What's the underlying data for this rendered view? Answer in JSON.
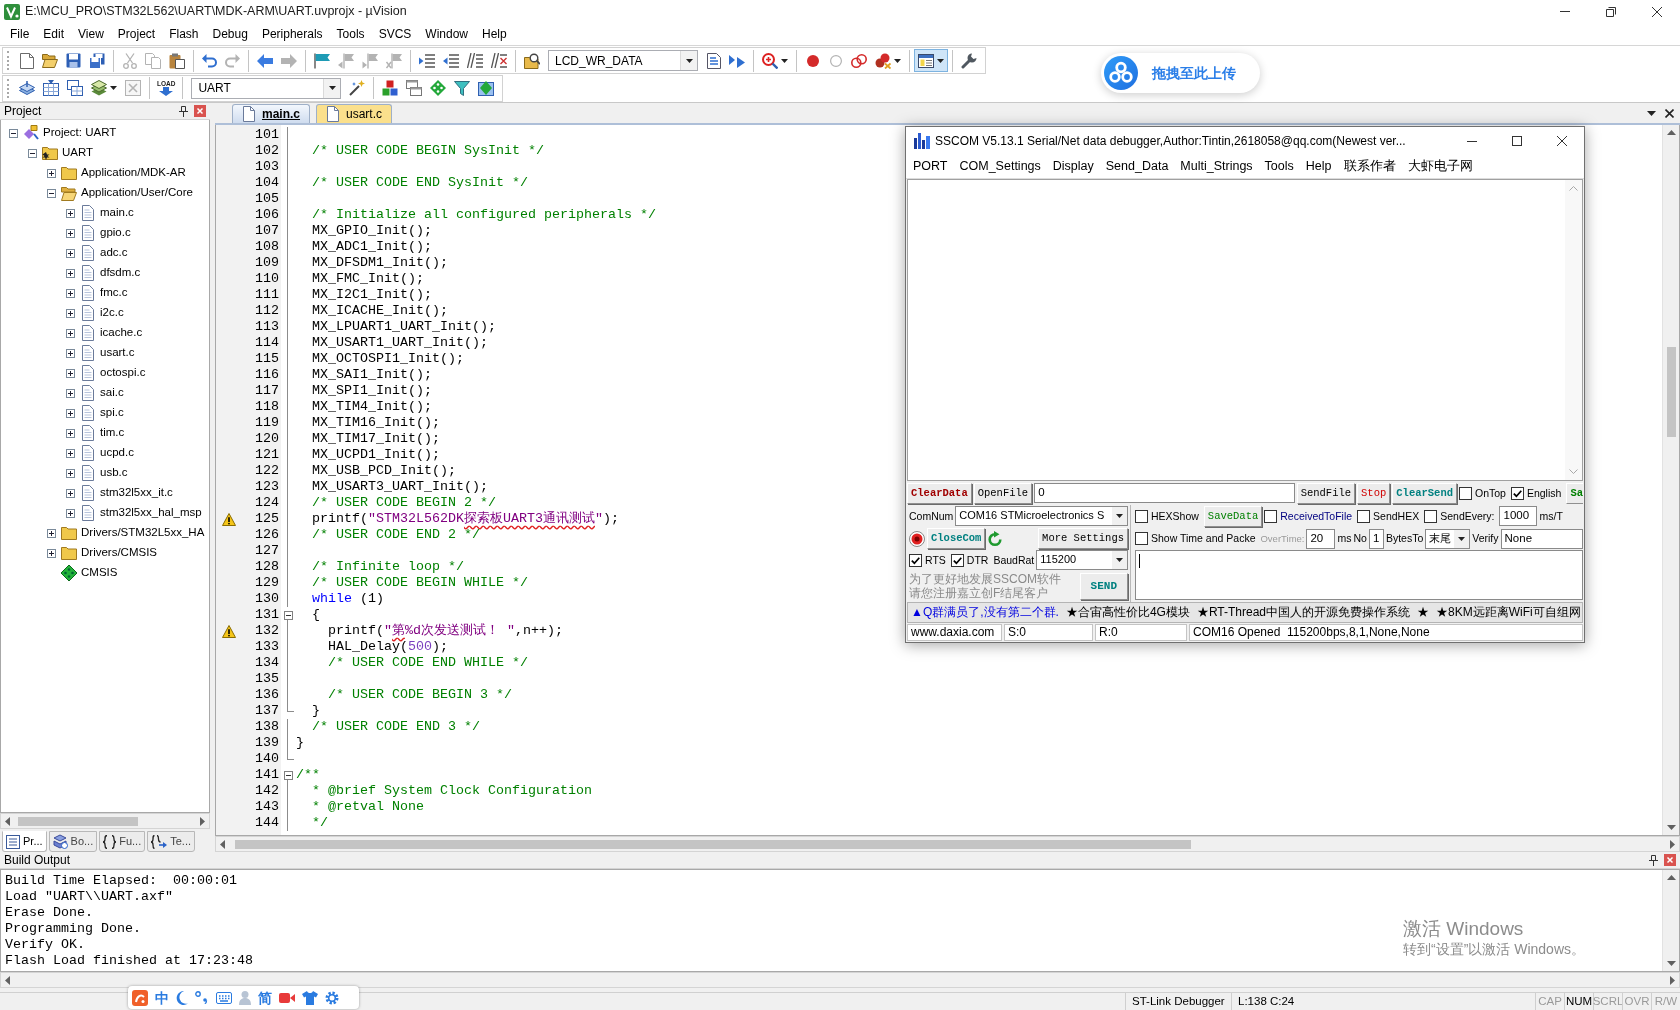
{
  "window": {
    "title": "E:\\MCU_PRO\\STM32L562\\UART\\MDK-ARM\\UART.uvprojx - µVision"
  },
  "menu": [
    "File",
    "Edit",
    "View",
    "Project",
    "Flash",
    "Debug",
    "Peripherals",
    "Tools",
    "SVCS",
    "Window",
    "Help"
  ],
  "toolbar_1": [
    [
      {
        "kind": "new",
        "disabled": false,
        "pressed": false
      },
      {
        "kind": "open",
        "disabled": false,
        "pressed": false
      },
      {
        "kind": "save",
        "disabled": false,
        "pressed": false
      },
      {
        "kind": "save_all",
        "disabled": false,
        "pressed": false
      }
    ],
    [
      {
        "kind": "cut",
        "disabled": true,
        "pressed": false
      },
      {
        "kind": "copy",
        "disabled": true,
        "pressed": false
      },
      {
        "kind": "paste",
        "disabled": false,
        "pressed": false
      }
    ],
    [
      {
        "kind": "undo",
        "disabled": false,
        "pressed": false
      },
      {
        "kind": "redo",
        "disabled": true,
        "pressed": false
      }
    ],
    [
      {
        "kind": "back",
        "disabled": false,
        "pressed": false
      },
      {
        "kind": "forward",
        "disabled": true,
        "pressed": false
      }
    ],
    [
      {
        "kind": "bookmark",
        "disabled": false,
        "pressed": false
      },
      {
        "kind": "prev_bookmark",
        "disabled": true,
        "pressed": false
      },
      {
        "kind": "next_bookmark",
        "disabled": true,
        "pressed": false
      },
      {
        "kind": "clear_bookmarks",
        "disabled": true,
        "pressed": false
      }
    ],
    [
      {
        "kind": "indent",
        "disabled": false,
        "pressed": false
      },
      {
        "kind": "unindent",
        "disabled": false,
        "pressed": false
      },
      {
        "kind": "comment",
        "disabled": false,
        "pressed": false
      },
      {
        "kind": "uncomment",
        "disabled": false,
        "pressed": false
      }
    ],
    [
      {
        "kind": "find_in_files",
        "disabled": false,
        "pressed": false
      },
      {
        "kind": "combo",
        "value": "LCD_WR_DATA"
      },
      {
        "kind": "find",
        "disabled": false,
        "pressed": false
      },
      {
        "kind": "incremental_find",
        "disabled": false,
        "pressed": false
      }
    ],
    [
      {
        "kind": "debug",
        "disabled": false,
        "pressed": false
      }
    ],
    [
      {
        "kind": "breakpoint",
        "disabled": false,
        "pressed": false
      },
      {
        "kind": "enable_breakpoint",
        "disabled": true,
        "pressed": false
      },
      {
        "kind": "disable_breakpoints",
        "disabled": false,
        "pressed": false
      },
      {
        "kind": "kill_breakpoints",
        "disabled": false,
        "pressed": false
      }
    ],
    [
      {
        "kind": "windows",
        "disabled": false,
        "pressed": true
      }
    ],
    [
      {
        "kind": "configure",
        "disabled": false,
        "pressed": false
      }
    ]
  ],
  "toolbar_2": [
    [
      {
        "kind": "translate",
        "disabled": false,
        "pressed": false
      },
      {
        "kind": "build",
        "disabled": false,
        "pressed": false
      },
      {
        "kind": "rebuild",
        "disabled": false,
        "pressed": false
      },
      {
        "kind": "batch_build",
        "disabled": false,
        "pressed": false
      },
      {
        "kind": "stop_build",
        "disabled": true,
        "pressed": false
      }
    ],
    [
      {
        "kind": "download",
        "label": "LOAD",
        "disabled": false,
        "pressed": false
      }
    ],
    [
      {
        "kind": "combo",
        "value": "UART"
      },
      {
        "kind": "target_options",
        "disabled": false,
        "pressed": false
      }
    ],
    [
      {
        "kind": "components",
        "disabled": false,
        "pressed": false
      },
      {
        "kind": "copy_windows",
        "disabled": false,
        "pressed": false
      },
      {
        "kind": "pack_installer",
        "disabled": false,
        "pressed": false
      },
      {
        "kind": "select_packs",
        "disabled": false,
        "pressed": false
      },
      {
        "kind": "rte",
        "disabled": false,
        "pressed": false
      }
    ]
  ],
  "upload_bubble": {
    "text": "拖拽至此上传"
  },
  "project_panel": {
    "title": "Project",
    "tree": [
      {
        "kind": "project",
        "label": "Project: UART",
        "expanded": true,
        "children": [
          {
            "kind": "target",
            "label": "UART",
            "expanded": true,
            "children": [
              {
                "kind": "group",
                "label": "Application/MDK-AR",
                "expanded": false
              },
              {
                "kind": "group",
                "label": "Application/User/Core",
                "expanded": true,
                "children": [
                  {
                    "kind": "file",
                    "label": "main.c",
                    "expanded": false
                  },
                  {
                    "kind": "file",
                    "label": "gpio.c",
                    "expanded": false
                  },
                  {
                    "kind": "file",
                    "label": "adc.c",
                    "expanded": false
                  },
                  {
                    "kind": "file",
                    "label": "dfsdm.c",
                    "expanded": false
                  },
                  {
                    "kind": "file",
                    "label": "fmc.c",
                    "expanded": false
                  },
                  {
                    "kind": "file",
                    "label": "i2c.c",
                    "expanded": false
                  },
                  {
                    "kind": "file",
                    "label": "icache.c",
                    "expanded": false
                  },
                  {
                    "kind": "file",
                    "label": "usart.c",
                    "expanded": false
                  },
                  {
                    "kind": "file",
                    "label": "octospi.c",
                    "expanded": false
                  },
                  {
                    "kind": "file",
                    "label": "sai.c",
                    "expanded": false
                  },
                  {
                    "kind": "file",
                    "label": "spi.c",
                    "expanded": false
                  },
                  {
                    "kind": "file",
                    "label": "tim.c",
                    "expanded": false
                  },
                  {
                    "kind": "file",
                    "label": "ucpd.c",
                    "expanded": false
                  },
                  {
                    "kind": "file",
                    "label": "usb.c",
                    "expanded": false
                  },
                  {
                    "kind": "file",
                    "label": "stm32l5xx_it.c",
                    "expanded": false
                  },
                  {
                    "kind": "file",
                    "label": "stm32l5xx_hal_msp",
                    "expanded": false
                  }
                ]
              },
              {
                "kind": "group",
                "label": "Drivers/STM32L5xx_HA",
                "expanded": false
              },
              {
                "kind": "group",
                "label": "Drivers/CMSIS",
                "expanded": false
              },
              {
                "kind": "component",
                "label": "CMSIS"
              }
            ]
          }
        ]
      }
    ],
    "tabs": [
      {
        "kind": "project",
        "label": "Pr...",
        "selected": true
      },
      {
        "kind": "books",
        "label": "Bo...",
        "selected": false
      },
      {
        "kind": "functions",
        "label": "Fu...",
        "selected": false
      },
      {
        "kind": "templates",
        "label": "Te...",
        "selected": false
      }
    ]
  },
  "editor": {
    "tabs": [
      {
        "label": "main.c",
        "selected": true
      },
      {
        "label": "usart.c",
        "selected": false
      }
    ],
    "lines": [
      {
        "number": "101",
        "fold_start": false,
        "fold_end": false,
        "warning": false
      },
      {
        "number": "102",
        "fold_start": false,
        "fold_end": false,
        "warning": false,
        "code": [
          {
            "kind": "comment",
            "text": "  /* USER CODE BEGIN SysInit */"
          }
        ]
      },
      {
        "number": "103",
        "fold_start": false,
        "fold_end": false,
        "warning": false
      },
      {
        "number": "104",
        "fold_start": false,
        "fold_end": false,
        "warning": false,
        "code": [
          {
            "kind": "comment",
            "text": "  /* USER CODE END SysInit */"
          }
        ]
      },
      {
        "number": "105",
        "fold_start": false,
        "fold_end": false,
        "warning": false
      },
      {
        "number": "106",
        "fold_start": false,
        "fold_end": false,
        "warning": false,
        "code": [
          {
            "kind": "comment",
            "text": "  /* Initialize all configured peripherals */"
          }
        ]
      },
      {
        "number": "107",
        "fold_start": false,
        "fold_end": false,
        "warning": false,
        "code": [
          {
            "kind": "plain",
            "text": "  MX_GPIO_Init();"
          }
        ]
      },
      {
        "number": "108",
        "fold_start": false,
        "fold_end": false,
        "warning": false,
        "code": [
          {
            "kind": "plain",
            "text": "  MX_ADC1_Init();"
          }
        ]
      },
      {
        "number": "109",
        "fold_start": false,
        "fold_end": false,
        "warning": false,
        "code": [
          {
            "kind": "plain",
            "text": "  MX_DFSDM1_Init();"
          }
        ]
      },
      {
        "number": "110",
        "fold_start": false,
        "fold_end": false,
        "warning": false,
        "code": [
          {
            "kind": "plain",
            "text": "  MX_FMC_Init();"
          }
        ]
      },
      {
        "number": "111",
        "fold_start": false,
        "fold_end": false,
        "warning": false,
        "code": [
          {
            "kind": "plain",
            "text": "  MX_I2C1_Init();"
          }
        ]
      },
      {
        "number": "112",
        "fold_start": false,
        "fold_end": false,
        "warning": false,
        "code": [
          {
            "kind": "plain",
            "text": "  MX_ICACHE_Init();"
          }
        ]
      },
      {
        "number": "113",
        "fold_start": false,
        "fold_end": false,
        "warning": false,
        "code": [
          {
            "kind": "plain",
            "text": "  MX_LPUART1_UART_Init();"
          }
        ]
      },
      {
        "number": "114",
        "fold_start": false,
        "fold_end": false,
        "warning": false,
        "code": [
          {
            "kind": "plain",
            "text": "  MX_USART1_UART_Init();"
          }
        ]
      },
      {
        "number": "115",
        "fold_start": false,
        "fold_end": false,
        "warning": false,
        "code": [
          {
            "kind": "plain",
            "text": "  MX_OCTOSPI1_Init();"
          }
        ]
      },
      {
        "number": "116",
        "fold_start": false,
        "fold_end": false,
        "warning": false,
        "code": [
          {
            "kind": "plain",
            "text": "  MX_SAI1_Init();"
          }
        ]
      },
      {
        "number": "117",
        "fold_start": false,
        "fold_end": false,
        "warning": false,
        "code": [
          {
            "kind": "plain",
            "text": "  MX_SPI1_Init();"
          }
        ]
      },
      {
        "number": "118",
        "fold_start": false,
        "fold_end": false,
        "warning": false,
        "code": [
          {
            "kind": "plain",
            "text": "  MX_TIM4_Init();"
          }
        ]
      },
      {
        "number": "119",
        "fold_start": false,
        "fold_end": false,
        "warning": false,
        "code": [
          {
            "kind": "plain",
            "text": "  MX_TIM16_Init();"
          }
        ]
      },
      {
        "number": "120",
        "fold_start": false,
        "fold_end": false,
        "warning": false,
        "code": [
          {
            "kind": "plain",
            "text": "  MX_TIM17_Init();"
          }
        ]
      },
      {
        "number": "121",
        "fold_start": false,
        "fold_end": false,
        "warning": false,
        "code": [
          {
            "kind": "plain",
            "text": "  MX_UCPD1_Init();"
          }
        ]
      },
      {
        "number": "122",
        "fold_start": false,
        "fold_end": false,
        "warning": false,
        "code": [
          {
            "kind": "plain",
            "text": "  MX_USB_PCD_Init();"
          }
        ]
      },
      {
        "number": "123",
        "fold_start": false,
        "fold_end": false,
        "warning": false,
        "code": [
          {
            "kind": "plain",
            "text": "  MX_USART3_UART_Init();"
          }
        ]
      },
      {
        "number": "124",
        "fold_start": false,
        "fold_end": false,
        "warning": false,
        "code": [
          {
            "kind": "comment",
            "text": "  /* USER CODE BEGIN 2 */"
          }
        ]
      },
      {
        "number": "125",
        "fold_start": false,
        "fold_end": false,
        "warning": true,
        "code": [
          {
            "kind": "plain",
            "text": "  printf("
          },
          {
            "kind": "string",
            "text": "\"STM32L562DK"
          },
          {
            "kind": "flagged",
            "text": "探索板UART3通讯测试"
          },
          {
            "kind": "string",
            "text": "\""
          },
          {
            "kind": "plain",
            "text": ");"
          }
        ]
      },
      {
        "number": "126",
        "fold_start": false,
        "fold_end": false,
        "warning": false,
        "code": [
          {
            "kind": "comment",
            "text": "  /* USER CODE END 2 */"
          }
        ]
      },
      {
        "number": "127",
        "fold_start": false,
        "fold_end": false,
        "warning": false
      },
      {
        "number": "128",
        "fold_start": false,
        "fold_end": false,
        "warning": false,
        "code": [
          {
            "kind": "comment",
            "text": "  /* Infinite loop */"
          }
        ]
      },
      {
        "number": "129",
        "fold_start": false,
        "fold_end": false,
        "warning": false,
        "code": [
          {
            "kind": "comment",
            "text": "  /* USER CODE BEGIN WHILE */"
          }
        ]
      },
      {
        "number": "130",
        "fold_start": false,
        "fold_end": false,
        "warning": false,
        "code": [
          {
            "kind": "keyword",
            "text": "  while"
          },
          {
            "kind": "plain",
            "text": " (1)"
          }
        ]
      },
      {
        "number": "131",
        "fold_start": true,
        "fold_end": false,
        "warning": false,
        "code": [
          {
            "kind": "plain",
            "text": "  {"
          }
        ]
      },
      {
        "number": "132",
        "fold_start": false,
        "fold_end": false,
        "warning": true,
        "code": [
          {
            "kind": "plain",
            "text": "    printf("
          },
          {
            "kind": "string",
            "text": "\""
          },
          {
            "kind": "flagged",
            "text": "第"
          },
          {
            "kind": "string",
            "text": "%d次发送测试！ \""
          },
          {
            "kind": "plain",
            "text": ",n++);"
          }
        ]
      },
      {
        "number": "133",
        "fold_start": false,
        "fold_end": false,
        "warning": false,
        "code": [
          {
            "kind": "plain",
            "text": "    HAL_Delay("
          },
          {
            "kind": "number",
            "text": "500"
          },
          {
            "kind": "plain",
            "text": ");"
          }
        ]
      },
      {
        "number": "134",
        "fold_start": false,
        "fold_end": false,
        "warning": false,
        "code": [
          {
            "kind": "comment",
            "text": "    /* USER CODE END WHILE */"
          }
        ]
      },
      {
        "number": "135",
        "fold_start": false,
        "fold_end": false,
        "warning": false
      },
      {
        "number": "136",
        "fold_start": false,
        "fold_end": false,
        "warning": false,
        "code": [
          {
            "kind": "comment",
            "text": "    /* USER CODE BEGIN 3 */"
          }
        ]
      },
      {
        "number": "137",
        "fold_start": false,
        "fold_end": true,
        "warning": false,
        "code": [
          {
            "kind": "plain",
            "text": "  }"
          }
        ]
      },
      {
        "number": "138",
        "fold_start": false,
        "fold_end": false,
        "warning": false,
        "code": [
          {
            "kind": "comment",
            "text": "  /* USER CODE END 3 */"
          }
        ]
      },
      {
        "number": "139",
        "fold_start": false,
        "fold_end": false,
        "warning": false,
        "code": [
          {
            "kind": "plain",
            "text": "}"
          }
        ]
      },
      {
        "number": "140",
        "fold_start": false,
        "fold_end": true,
        "warning": false
      },
      {
        "number": "141",
        "fold_start": true,
        "fold_end": false,
        "warning": false,
        "code": [
          {
            "kind": "comment",
            "text": "/**"
          }
        ]
      },
      {
        "number": "142",
        "fold_start": false,
        "fold_end": false,
        "warning": false,
        "code": [
          {
            "kind": "comment",
            "text": "  * @brief System Clock Configuration"
          }
        ]
      },
      {
        "number": "143",
        "fold_start": false,
        "fold_end": false,
        "warning": false,
        "code": [
          {
            "kind": "comment",
            "text": "  * @retval None"
          }
        ]
      },
      {
        "number": "144",
        "fold_start": false,
        "fold_end": false,
        "warning": false,
        "code": [
          {
            "kind": "comment",
            "text": "  */"
          }
        ]
      }
    ]
  },
  "sscom": {
    "title": "SSCOM V5.13.1 Serial/Net data debugger,Author:Tintin,2618058@qq.com(Newest ver...",
    "menu": [
      "PORT",
      "COM_Settings",
      "Display",
      "Send_Data",
      "Multi_Strings",
      "Tools",
      "Help",
      "联系作者",
      "大虾电子网"
    ],
    "clear_data": "ClearData",
    "open_file": "OpenFile",
    "file_path": "0",
    "send_file": "SendFile",
    "stop": "Stop",
    "clear_send": "ClearSend",
    "on_top": {
      "label": "OnTop",
      "checked": false
    },
    "english": {
      "label": "English",
      "checked": true
    },
    "partial_button": "Sa",
    "port_label": "ComNum",
    "port": "COM16 STMicroelectronics S",
    "port_open": true,
    "close_port": "CloseCom",
    "more_settings": "More Settings",
    "rts": {
      "label": "RTS",
      "checked": true
    },
    "dtr": {
      "label": "DTR",
      "checked": true
    },
    "baud_label": "BaudRat",
    "baud_rate": "115200",
    "promo": [
      "为了更好地发展SSCOM软件",
      "请您注册嘉立创F结尾客户"
    ],
    "send": "SEND",
    "hex_show": {
      "label": "HEXShow",
      "checked": false
    },
    "save_data": "SaveData",
    "received_to_file": {
      "label": "ReceivedToFile",
      "checked": false
    },
    "send_hex": {
      "label": "SendHEX",
      "checked": false
    },
    "send_every": {
      "label": "SendEvery:",
      "checked": false
    },
    "interval": "1000",
    "interval_unit": "ms/T",
    "show_time": {
      "label": "Show Time and Packe",
      "checked": false
    },
    "overtime": {
      "label": "OverTime:",
      "disabled": true,
      "value": "20",
      "unit": "ms"
    },
    "packet_no_label": "No",
    "packet_no": "1",
    "bytes_to_label": "BytesTo",
    "bytes_to": "末尾",
    "verify_label": "Verify",
    "verify": "None",
    "send_focused": true,
    "ticker": [
      {
        "kind": "notice",
        "text": "▲Q群满员了,没有第二个群."
      },
      {
        "kind": "ad",
        "text": "★合宙高性价比4G模块"
      },
      {
        "kind": "ad",
        "text": "★RT-Thread中国人的开源免费操作系统"
      },
      {
        "kind": "ad",
        "text": "★"
      },
      {
        "kind": "ad",
        "text": "★8KM远距离WiFi可自组网"
      }
    ],
    "status": [
      "www.daxia.com",
      "S:0",
      "R:0",
      "COM16 Opened  115200bps,8,1,None,None"
    ]
  },
  "build_output": {
    "title": "Build Output",
    "lines": [
      "Build Time Elapsed:  00:00:01",
      "Load \"UART\\\\UART.axf\"",
      "Erase Done.",
      "Programming Done.",
      "Verify OK.",
      "Flash Load finished at 17:23:48"
    ]
  },
  "activation_notice": {
    "title": "激活 Windows",
    "hint": "转到“设置”以激活 Windows。"
  },
  "ime_bar": {
    "items": [
      {
        "kind": "logo"
      },
      {
        "kind": "mode",
        "text": "中"
      },
      {
        "kind": "moon"
      },
      {
        "kind": "punctuation"
      },
      {
        "kind": "keyboard"
      },
      {
        "kind": "user"
      },
      {
        "kind": "script",
        "text": "简"
      },
      {
        "kind": "video"
      },
      {
        "kind": "shirt"
      },
      {
        "kind": "gear"
      }
    ]
  },
  "status_bar": {
    "debugger": "ST-Link Debugger",
    "position": "L:138 C:24",
    "indicators": [
      {
        "label": "CAP",
        "on": false
      },
      {
        "label": "NUM",
        "on": true
      },
      {
        "label": "SCRL",
        "on": false
      },
      {
        "label": "OVR",
        "on": false
      },
      {
        "label": "R/W",
        "on": false
      }
    ]
  }
}
